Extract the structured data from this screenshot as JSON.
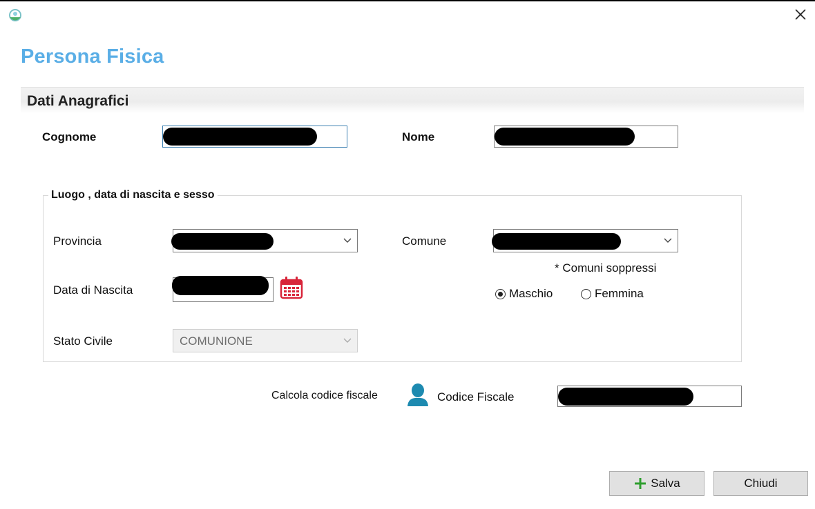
{
  "window": {
    "app_icon": "app-logo-icon",
    "close_icon": "close-icon"
  },
  "page": {
    "title": "Persona Fisica",
    "title_color": "#5aaee6"
  },
  "anagrafica": {
    "header": "Dati Anagrafici",
    "cognome_label": "Cognome",
    "nome_label": "Nome"
  },
  "nascita": {
    "legend": "Luogo , data di nascita e sesso",
    "provincia_label": "Provincia",
    "comune_label": "Comune",
    "comuni_soppressi": "* Comuni soppressi",
    "data_nascita_label": "Data di Nascita",
    "calendar_icon": "calendar-icon",
    "calendar_color": "#d8253a",
    "sesso": {
      "maschio": "Maschio",
      "femmina": "Femmina",
      "selected": "Maschio"
    },
    "stato_civile_label": "Stato Civile",
    "stato_civile_value": "COMUNIONE"
  },
  "codice_fiscale": {
    "calcola_label": "Calcola codice fiscale",
    "icon": "person-icon",
    "icon_color": "#1d8ab0",
    "label": "Codice Fiscale"
  },
  "footer": {
    "salva_label": "Salva",
    "salva_icon": "plus-icon",
    "salva_icon_color": "#2f9e2f",
    "chiudi_label": "Chiudi"
  }
}
